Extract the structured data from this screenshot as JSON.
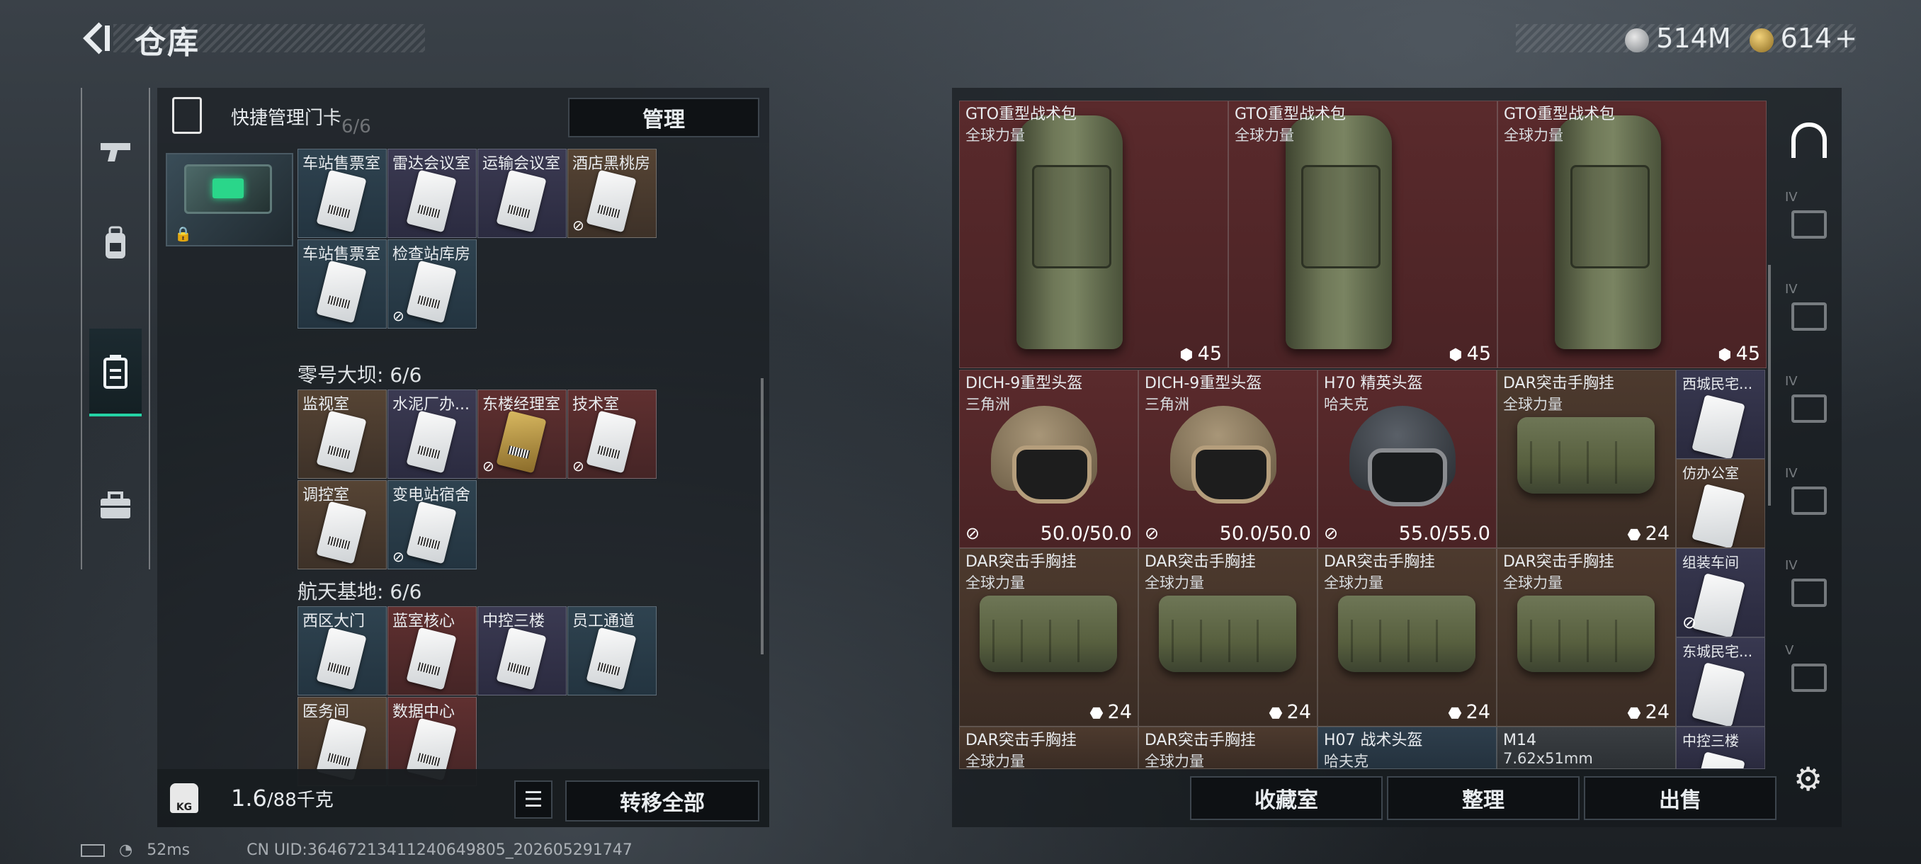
{
  "header": {
    "title": "仓库"
  },
  "currency": [
    {
      "icon": "silver-coin-icon",
      "value": "514M"
    },
    {
      "icon": "gold-coin-icon",
      "value": "614",
      "add": "+"
    }
  ],
  "left_nav": [
    "weapon-tab",
    "backpack-tab",
    "keycard-tab",
    "toolbox-tab"
  ],
  "left_panel": {
    "header_label": "快捷管理门卡",
    "header_bg_text": "6/6",
    "manage_button": "管理",
    "sections": [
      {
        "title": "",
        "cells": [
          {
            "name": "车站售票室",
            "bg": "blue"
          },
          {
            "name": "雷达会议室",
            "bg": "purple"
          },
          {
            "name": "运输会议室",
            "bg": "purple"
          },
          {
            "name": "酒店黑桃房",
            "bg": "brown",
            "nodrop": true
          },
          {
            "name": "车站售票室",
            "bg": "blue"
          },
          {
            "name": "检查站库房",
            "bg": "blue",
            "nodrop": true
          }
        ]
      },
      {
        "title": "零号大坝: 6/6",
        "cells": [
          {
            "name": "监视室",
            "bg": "brown"
          },
          {
            "name": "水泥厂办...",
            "bg": "purple"
          },
          {
            "name": "东楼经理室",
            "bg": "red",
            "nodrop": true,
            "gold": true
          },
          {
            "name": "技术室",
            "bg": "red",
            "nodrop": true
          },
          {
            "name": "调控室",
            "bg": "brown"
          },
          {
            "name": "变电站宿舍",
            "bg": "blue",
            "nodrop": true
          }
        ]
      },
      {
        "title": "航天基地: 6/6",
        "cells": [
          {
            "name": "西区大门",
            "bg": "blue"
          },
          {
            "name": "蓝室核心",
            "bg": "red"
          },
          {
            "name": "中控三楼",
            "bg": "purple"
          },
          {
            "name": "员工通道",
            "bg": "blue"
          },
          {
            "name": "医务间",
            "bg": "brown"
          },
          {
            "name": "数据中心",
            "bg": "red"
          }
        ]
      }
    ],
    "weight": {
      "value": "1.6",
      "capacity": "/88千克",
      "icon_text": "KG"
    },
    "transfer_all": "转移全部"
  },
  "stash": {
    "rows": [
      [
        {
          "name": "GTO重型战术包",
          "sub": "全球力量",
          "val": "45",
          "bg": "red",
          "kind": "backpack"
        },
        {
          "name": "GTO重型战术包",
          "sub": "全球力量",
          "val": "45",
          "bg": "red",
          "kind": "backpack"
        },
        {
          "name": "GTO重型战术包",
          "sub": "全球力量",
          "val": "45",
          "bg": "red",
          "kind": "backpack"
        }
      ],
      [
        {
          "name": "DICH-9重型头盔",
          "sub": "三角洲",
          "val": "50.0/50.0",
          "bg": "red",
          "kind": "helmet-tan"
        },
        {
          "name": "DICH-9重型头盔",
          "sub": "三角洲",
          "val": "50.0/50.0",
          "bg": "red",
          "kind": "helmet-tan"
        },
        {
          "name": "H70 精英头盔",
          "sub": "哈夫克",
          "val": "55.0/55.0",
          "bg": "red",
          "kind": "helmet-dark"
        },
        {
          "name": "DAR突击手胸挂",
          "sub": "全球力量",
          "val": "24",
          "bg": "brown",
          "kind": "vest"
        }
      ],
      [
        {
          "name": "DAR突击手胸挂",
          "sub": "全球力量",
          "val": "24",
          "bg": "brown",
          "kind": "vest"
        },
        {
          "name": "DAR突击手胸挂",
          "sub": "全球力量",
          "val": "24",
          "bg": "brown",
          "kind": "vest"
        },
        {
          "name": "DAR突击手胸挂",
          "sub": "全球力量",
          "val": "24",
          "bg": "brown",
          "kind": "vest"
        },
        {
          "name": "DAR突击手胸挂",
          "sub": "全球力量",
          "val": "24",
          "bg": "brown",
          "kind": "vest"
        }
      ],
      [
        {
          "name": "DAR突击手胸挂",
          "sub": "全球力量",
          "bg": "brown"
        },
        {
          "name": "DAR突击手胸挂",
          "sub": "全球力量",
          "bg": "brown"
        },
        {
          "name": "H07 战术头盔",
          "sub": "哈夫克",
          "bg": "blue"
        },
        {
          "name": "M14",
          "sub": "7.62x51mm",
          "bg": "grey"
        }
      ]
    ],
    "side_column": [
      {
        "name": "西城民宅...",
        "bg": "purple"
      },
      {
        "name": "仿办公室",
        "bg": "brown"
      },
      {
        "name": "组装车间",
        "bg": "purple",
        "nodrop": true
      },
      {
        "name": "东城民宅...",
        "bg": "purple"
      },
      {
        "name": "中控三楼",
        "bg": "purple"
      }
    ],
    "buttons": {
      "collection": "收藏室",
      "sort": "整理",
      "sell": "出售"
    }
  },
  "right_tabs": [
    {
      "level": "",
      "icon": "stash-main-icon"
    },
    {
      "level": "IV",
      "icon": "stash-tab-icon"
    },
    {
      "level": "IV",
      "icon": "stash-tab-icon"
    },
    {
      "level": "IV",
      "icon": "stash-tab-icon"
    },
    {
      "level": "IV",
      "icon": "stash-tab-add-icon"
    },
    {
      "level": "IV",
      "icon": "stash-tab-icon"
    },
    {
      "level": "V",
      "icon": "stash-tab-icon"
    }
  ],
  "status_bar": {
    "ping": "52ms",
    "uid": "CN UID:3646721341124064980​5_202605291747"
  }
}
